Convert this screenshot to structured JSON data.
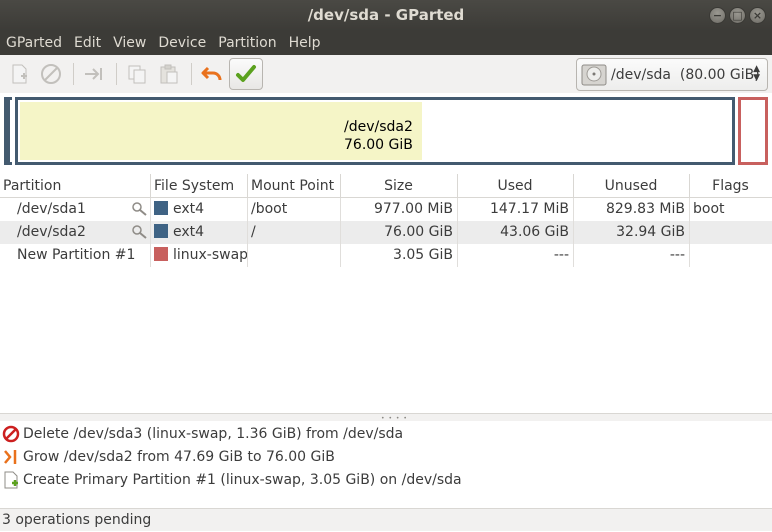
{
  "window": {
    "title": "/dev/sda - GParted"
  },
  "menu": [
    "GParted",
    "Edit",
    "View",
    "Device",
    "Partition",
    "Help"
  ],
  "toolbar": {
    "device_label": "/dev/sda  (80.00 GiB)"
  },
  "diskmap": {
    "label_name": "/dev/sda2",
    "label_size": "76.00 GiB",
    "used_fraction": 0.5666
  },
  "table": {
    "headers": [
      "Partition",
      "File System",
      "Mount Point",
      "Size",
      "Used",
      "Unused",
      "Flags"
    ],
    "rows": [
      {
        "partition": "/dev/sda1",
        "fs": "ext4",
        "fs_color": "#3f6384",
        "mount": "/boot",
        "size": "977.00 MiB",
        "used": "147.17 MiB",
        "unused": "829.83 MiB",
        "flags": "boot",
        "locked": true
      },
      {
        "partition": "/dev/sda2",
        "fs": "ext4",
        "fs_color": "#3f6384",
        "mount": "/",
        "size": "76.00 GiB",
        "used": "43.06 GiB",
        "unused": "32.94 GiB",
        "flags": "",
        "locked": true
      },
      {
        "partition": "New Partition #1",
        "fs": "linux-swap",
        "fs_color": "#c8605e",
        "mount": "",
        "size": "3.05 GiB",
        "used": "---",
        "unused": "---",
        "flags": "",
        "locked": false
      }
    ]
  },
  "operations": [
    {
      "icon": "delete-icon",
      "text": "Delete /dev/sda3 (linux-swap, 1.36 GiB) from /dev/sda"
    },
    {
      "icon": "grow-icon",
      "text": "Grow /dev/sda2 from 47.69 GiB to 76.00 GiB"
    },
    {
      "icon": "create-icon",
      "text": "Create Primary Partition #1 (linux-swap, 3.05 GiB) on /dev/sda"
    }
  ],
  "status": {
    "text": "3 operations pending"
  }
}
